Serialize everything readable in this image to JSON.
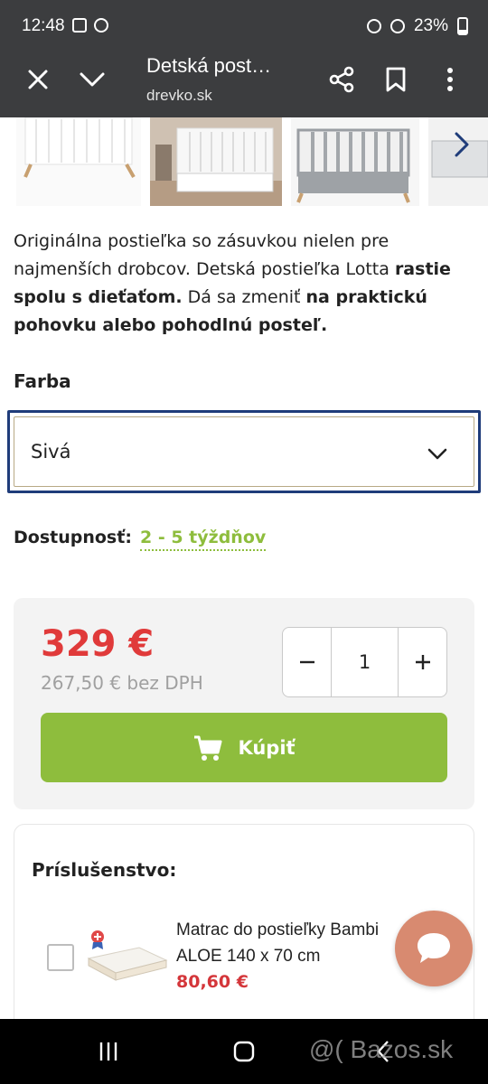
{
  "status_bar": {
    "time": "12:48",
    "battery": "23%",
    "icons": [
      "gallery-icon",
      "notification-icon",
      "alarm-icon",
      "wifi-icon",
      "volte-icon",
      "signal-icon",
      "battery-icon"
    ]
  },
  "browser_bar": {
    "title": "Detská post…",
    "domain": "drevko.sk"
  },
  "product": {
    "description_parts": [
      "Originálna postieľka so zásuvkou nielen pre najmenších drobcov. Detská postieľka Lotta ",
      "rastie spolu s dieťaťom.",
      " Dá sa zmeniť ",
      "na praktickú pohovku alebo pohodlnú posteľ."
    ],
    "color_label": "Farba",
    "color_value": "Sivá",
    "availability_label": "Dostupnosť:",
    "availability_value": "2 - 5 týždňov"
  },
  "pricing": {
    "price": "329 €",
    "price_without_vat": "267,50 € bez DPH",
    "quantity": "1",
    "buy_label": "Kúpiť"
  },
  "accessories": {
    "title": "Príslušenstvo:",
    "items": [
      {
        "name": "Matrac do postieľky Bambi ALOE 140 x 70 cm",
        "price": "80,60 €"
      }
    ]
  },
  "watermark": "@( Bazos.sk",
  "colors": {
    "accent_green": "#8ebd3d",
    "price_red": "#e03a3a",
    "select_border": "#1f3c7a",
    "chat_button": "#d88a70",
    "browser_bar": "#3c3d3f"
  }
}
